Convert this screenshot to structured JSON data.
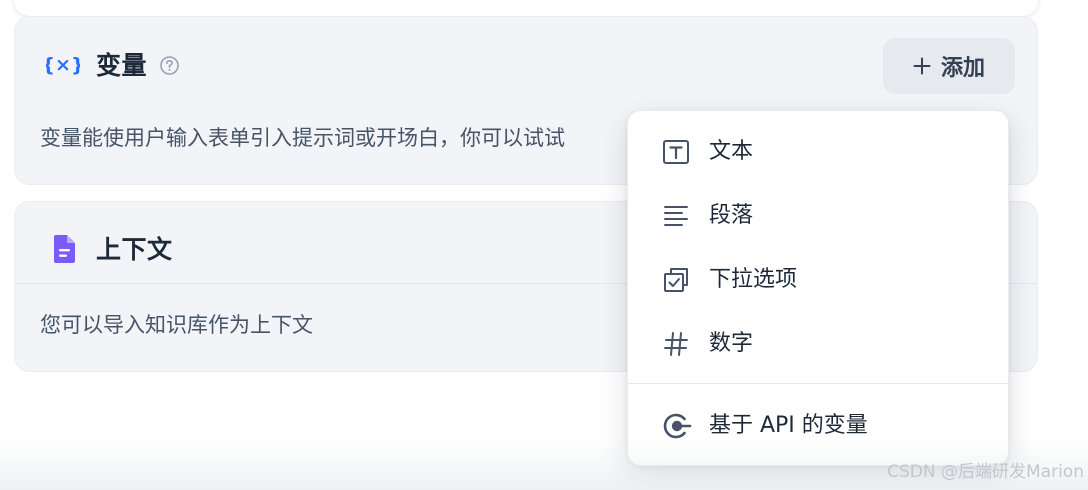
{
  "variables_card": {
    "icon": "variable-braces-icon",
    "title": "变量",
    "help_icon": "help-circle-icon",
    "add_button": {
      "label": "添加",
      "icon": "plus-icon"
    },
    "description": "变量能使用户输入表单引入提示词或开场白，你可以试试"
  },
  "context_card": {
    "icon": "document-icon",
    "title": "上下文",
    "description": "您可以导入知识库作为上下文"
  },
  "add_menu": {
    "items": [
      {
        "label": "文本",
        "icon": "text-icon"
      },
      {
        "label": "段落",
        "icon": "paragraph-lines-icon"
      },
      {
        "label": "下拉选项",
        "icon": "select-checkbox-icon"
      },
      {
        "label": "数字",
        "icon": "hash-icon"
      }
    ],
    "api_item": {
      "label": "基于 API 的变量",
      "icon": "api-icon"
    }
  },
  "watermark": "CSDN @后端研发Marion",
  "colors": {
    "card_bg": "#f2f4f7",
    "accent_blue": "#2970ff",
    "accent_purple": "#7a5af8",
    "text_primary": "#1d2939",
    "text_secondary": "#475467"
  }
}
